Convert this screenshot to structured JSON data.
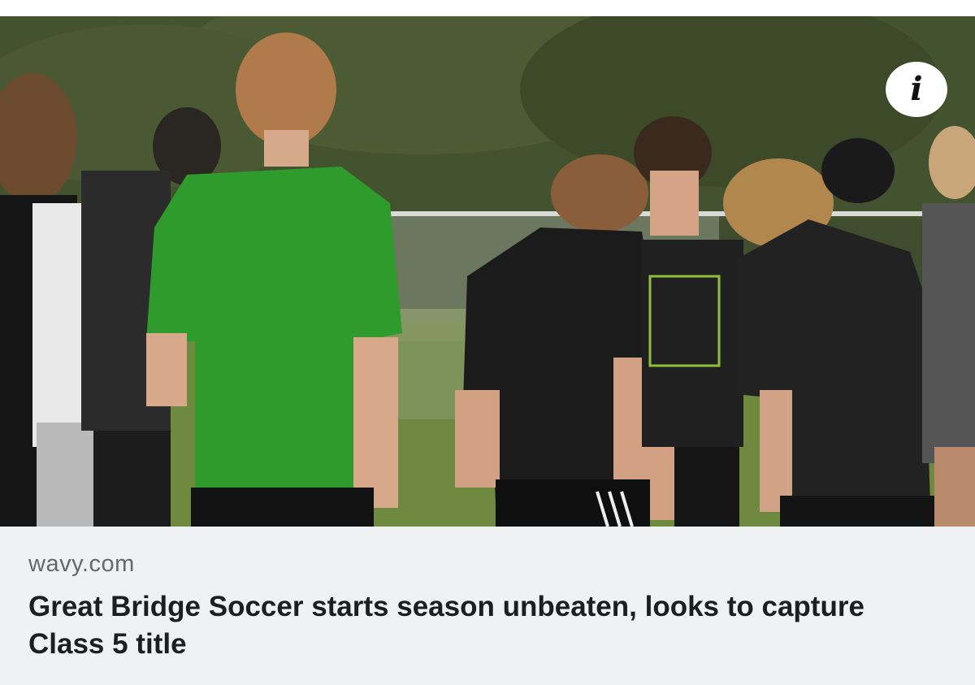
{
  "link_preview": {
    "source": "wavy.com",
    "headline": "Great Bridge Soccer starts season unbeaten, looks to capture Class 5 title",
    "info_button_glyph": "i"
  },
  "colors": {
    "caption_background": "#f0f1f3",
    "source_text": "#65676b",
    "headline_text": "#1c1e21",
    "info_button_background": "#ffffff"
  },
  "icons": {
    "info_button": "info-icon"
  }
}
